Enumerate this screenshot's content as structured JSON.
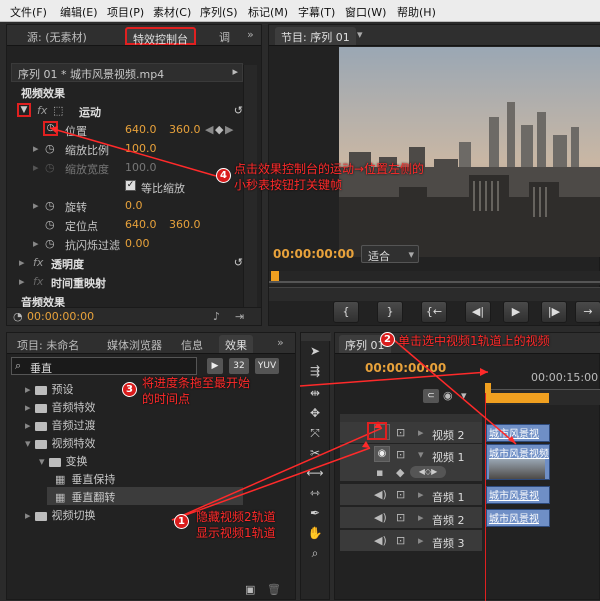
{
  "menu": [
    "文件(F)",
    "编辑(E)",
    "项目(P)",
    "素材(C)",
    "序列(S)",
    "标记(M)",
    "字幕(T)",
    "窗口(W)",
    "帮助(H)"
  ],
  "left_panel": {
    "tabs": [
      "源: (无素材)",
      "特效控制台",
      "调"
    ],
    "clip_header": "序列 01 * 城市风景视频.mp4",
    "video_effects_label": "视频效果",
    "motion_label": "运动",
    "position_label": "位置",
    "position_x": "640.0",
    "position_y": "360.0",
    "scale_label": "缩放比例",
    "scale_value": "100.0",
    "scale_width_label": "缩放宽度",
    "scale_width_value": "100.0",
    "uniform_scale_label": "等比缩放",
    "rotation_label": "旋转",
    "rotation_value": "0.0",
    "anchor_label": "定位点",
    "anchor_x": "640.0",
    "anchor_y": "360.0",
    "antiflicker_label": "抗闪烁过滤",
    "antiflicker_value": "0.00",
    "opacity_label": "透明度",
    "timeremap_label": "时间重映射",
    "audio_effects_label": "音频效果",
    "timecode": "00:00:00:00"
  },
  "program_monitor": {
    "tab": "节目: 序列 01",
    "timecode": "00:00:00:00",
    "fit_option": "适合",
    "transport": [
      "{",
      "}",
      "{←",
      "◀|",
      "▶",
      "|▶",
      "→"
    ]
  },
  "effects_panel": {
    "tabs": [
      "项目: 未命名",
      "媒体浏览器",
      "信息",
      "效果"
    ],
    "search_value": "垂直",
    "search_icons": [
      "32",
      "YUV"
    ],
    "tree": [
      {
        "label": "预设",
        "level": 0,
        "kind": "folder"
      },
      {
        "label": "音频特效",
        "level": 0,
        "kind": "folder"
      },
      {
        "label": "音频过渡",
        "level": 0,
        "kind": "folder"
      },
      {
        "label": "视频特效",
        "level": 0,
        "kind": "folder"
      },
      {
        "label": "变换",
        "level": 1,
        "kind": "folder"
      },
      {
        "label": "垂直保持",
        "level": 2,
        "kind": "effect"
      },
      {
        "label": "垂直翻转",
        "level": 2,
        "kind": "effect"
      },
      {
        "label": "视频切换",
        "level": 0,
        "kind": "folder"
      }
    ]
  },
  "timeline": {
    "tab": "序列 01",
    "timecode": "00:00:00:00",
    "ruler_label": "00:00:15:00",
    "tracks": [
      {
        "name": "视频 2",
        "clip": "城市风景视"
      },
      {
        "name": "视频 1",
        "clip": "城市风景视频"
      },
      {
        "name": "音频 1",
        "clip": "城市风景视"
      },
      {
        "name": "音频 2",
        "clip": "城市风景视"
      },
      {
        "name": "音频 3",
        "clip": ""
      }
    ]
  },
  "annotations": {
    "step1_num": "1",
    "step1_line1": "隐藏视频2轨道",
    "step1_line2": "显示视频1轨道",
    "step2_num": "2",
    "step2_text": "单击选中视频1轨道上的视频",
    "step3_num": "3",
    "step3_line1": "将进度条拖至最开始",
    "step3_line2": "的时间点",
    "step4_num": "4",
    "step4_line1": "点击效果控制台的运动→位置左侧的",
    "step4_line2": "小秒表按钮打关键帧"
  },
  "colors": {
    "accent_orange": "#e8a23b",
    "annotation_red": "#ff2a2a",
    "clip_blue": "#6f8fc6",
    "playhead_orange": "#f0a020"
  }
}
